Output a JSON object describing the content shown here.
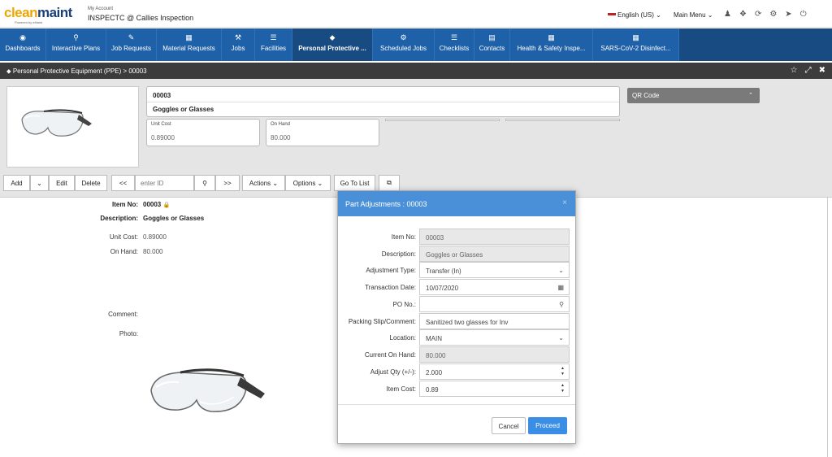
{
  "header": {
    "logo_part1": "clean",
    "logo_part2": "maint",
    "logo_sub": "Powered by eMaint",
    "account_label": "My Account",
    "account_name": "INSPECTC @ Callies Inspection",
    "language": "English (US) ⌄",
    "main_menu": "Main Menu ⌄",
    "icons": [
      "user-icon",
      "network-icon",
      "refresh-icon",
      "gear-icon",
      "location-arrow-icon",
      "power-icon"
    ]
  },
  "nav": {
    "items": [
      {
        "label": "Dashboards",
        "icon": "◉"
      },
      {
        "label": "Interactive Plans",
        "icon": "⚲"
      },
      {
        "label": "Job Requests",
        "icon": "✎"
      },
      {
        "label": "Material Requests",
        "icon": "▦"
      },
      {
        "label": "Jobs",
        "icon": "⚒"
      },
      {
        "label": "Facilities",
        "icon": "☰"
      },
      {
        "label": "Personal Protective ...",
        "icon": "⬥"
      },
      {
        "label": "Scheduled Jobs",
        "icon": "⚙"
      },
      {
        "label": "Checklists",
        "icon": "☰"
      },
      {
        "label": "Contacts",
        "icon": "▤"
      },
      {
        "label": "Health & Safety Inspe...",
        "icon": "▦"
      },
      {
        "label": "SARS-CoV-2 Disinfect...",
        "icon": "▦"
      }
    ]
  },
  "breadcrumb": "Personal Protective Equipment (PPE) > 00003",
  "record": {
    "item_no": "00003",
    "description": "Goggles or Glasses",
    "unit_cost_label": "Unit Cost",
    "unit_cost": "0.89000",
    "on_hand_label": "On Hand",
    "on_hand": "80.000",
    "qr_label": "QR Code"
  },
  "toolbar": {
    "add": "Add",
    "edit": "Edit",
    "delete": "Delete",
    "prev": "<<",
    "id_placeholder": "enter ID",
    "next": ">>",
    "actions": "Actions ⌄",
    "options": "Options ⌄",
    "go_to_list": "Go To List"
  },
  "detail": {
    "item_no_label": "Item No:",
    "item_no": "00003",
    "description_label": "Description:",
    "description": "Goggles or Glasses",
    "unit_cost_label": "Unit Cost:",
    "unit_cost": "0.89000",
    "on_hand_label": "On Hand:",
    "on_hand": "80.000",
    "comment_label": "Comment:",
    "photo_label": "Photo:"
  },
  "modal": {
    "title": "Part Adjustments : 00003",
    "close": "×",
    "fields": [
      {
        "label": "Item No:",
        "value": "00003"
      },
      {
        "label": "Description:",
        "value": "Goggles or Glasses"
      },
      {
        "label": "Adjustment Type:",
        "value": "Transfer (In)"
      },
      {
        "label": "Transaction Date:",
        "value": "10/07/2020"
      },
      {
        "label": "PO No.:",
        "value": ""
      },
      {
        "label": "Packing Slip/Comment:",
        "value": "Sanitized two glasses for Inv"
      },
      {
        "label": "Location:",
        "value": "MAIN"
      },
      {
        "label": "Current On Hand:",
        "value": "80.000"
      },
      {
        "label": "Adjust Qty (+/-):",
        "value": "2.000"
      },
      {
        "label": "Item Cost:",
        "value": "0.89"
      }
    ],
    "cancel": "Cancel",
    "proceed": "Proceed"
  }
}
